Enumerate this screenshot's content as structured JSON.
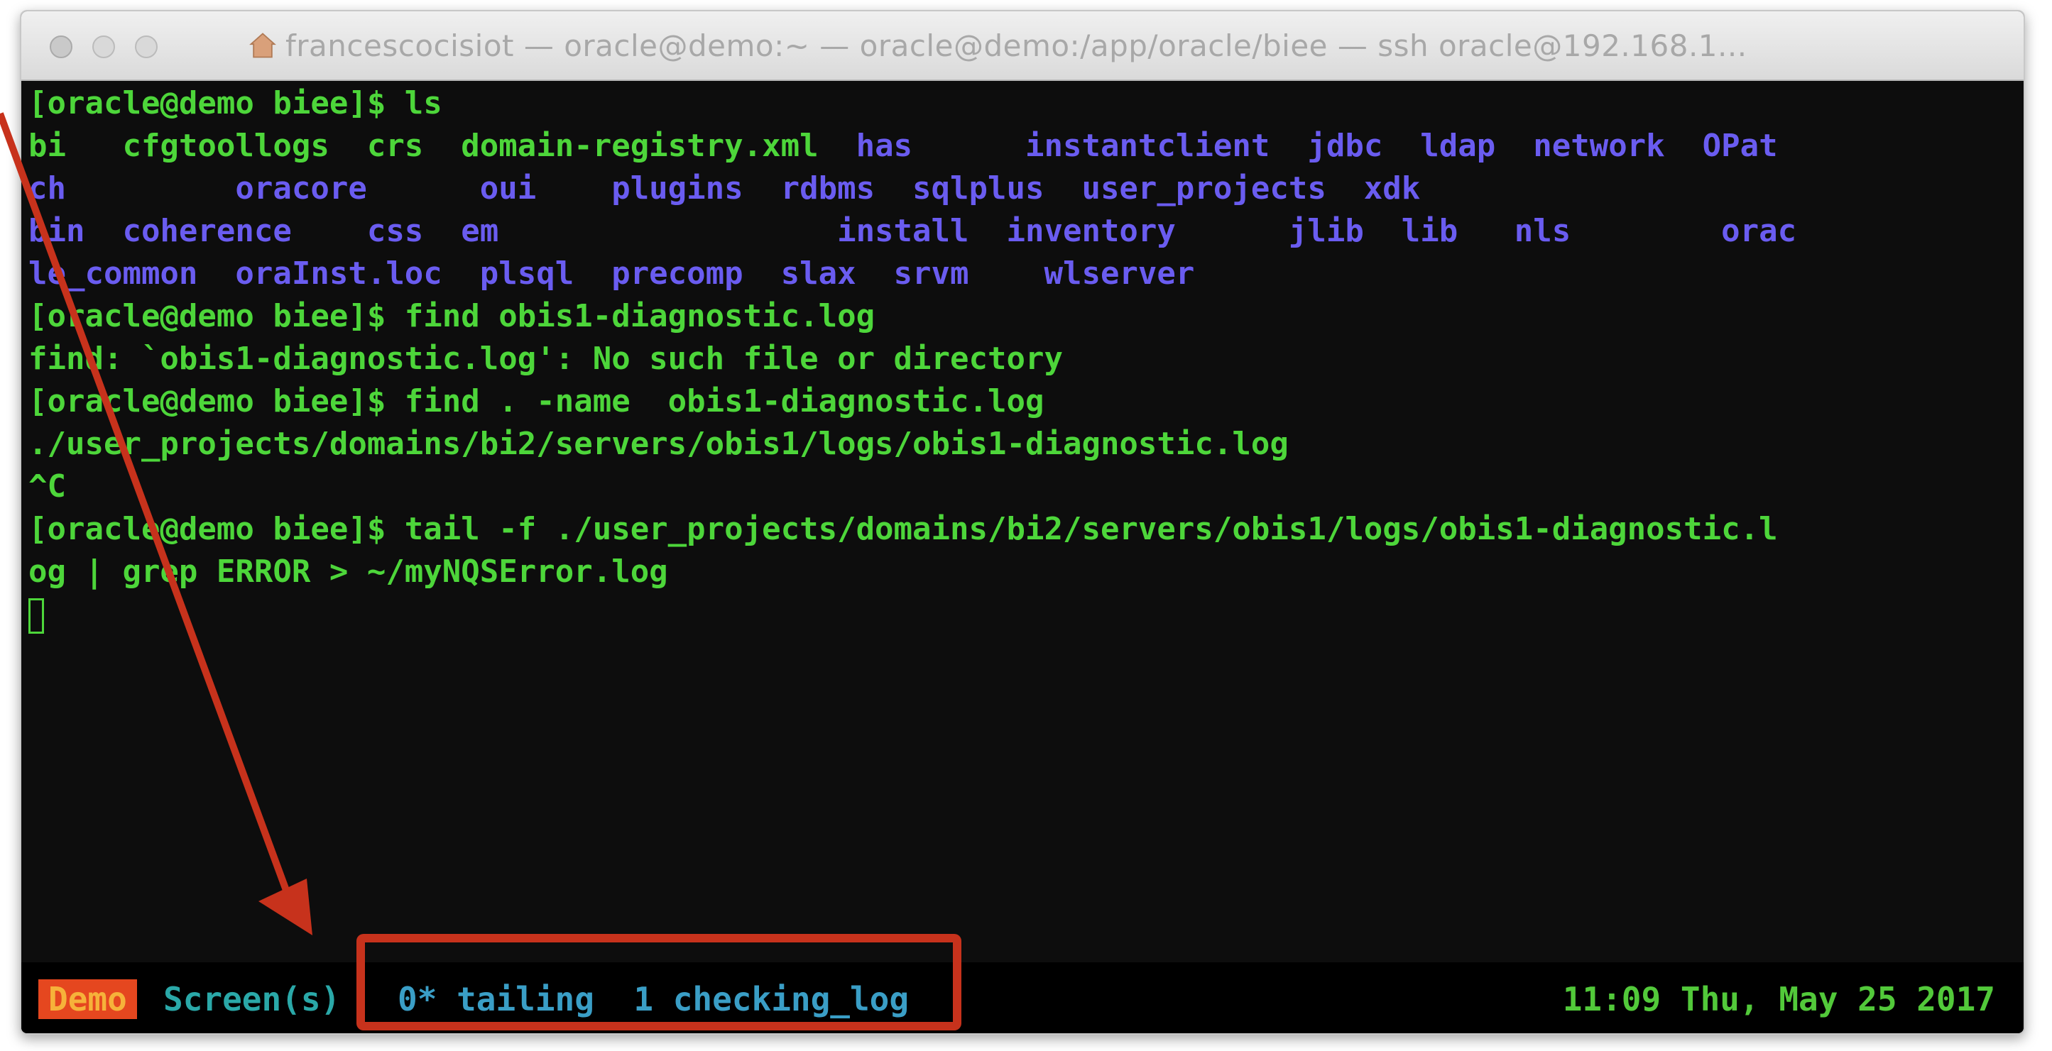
{
  "window": {
    "title": "francescocisiot — oracle@demo:~ — oracle@demo:/app/oracle/biee — ssh oracle@192.168.1..."
  },
  "terminal": {
    "lines": [
      {
        "parts": [
          {
            "text": "[oracle@demo biee]$ ls",
            "style": "green"
          }
        ]
      },
      {
        "parts": [
          {
            "text": "bi   cfgtoollogs  crs  domain-registry.xml  ",
            "style": "green"
          },
          {
            "text": "has      instantclient  jdbc  ldap  network  OPat",
            "style": "blue"
          }
        ]
      },
      {
        "parts": [
          {
            "text": "ch         oracore      oui    plugins  rdbms  sqlplus  user_projects  xdk",
            "style": "blue"
          }
        ]
      },
      {
        "parts": [
          {
            "text": "bin  coherence    css  em                  install  inventory      jlib  lib   nls        orac",
            "style": "blue"
          }
        ]
      },
      {
        "parts": [
          {
            "text": "le_common  oraInst.loc  plsql  precomp  slax  srvm    wlserver",
            "style": "blue"
          }
        ]
      },
      {
        "parts": [
          {
            "text": "[oracle@demo biee]$ find obis1-diagnostic.log",
            "style": "green"
          }
        ]
      },
      {
        "parts": [
          {
            "text": "find: `obis1-diagnostic.log': No such file or directory",
            "style": "green"
          }
        ]
      },
      {
        "parts": [
          {
            "text": "[oracle@demo biee]$ find . -name  obis1-diagnostic.log",
            "style": "green"
          }
        ]
      },
      {
        "parts": [
          {
            "text": "./user_projects/domains/bi2/servers/obis1/logs/obis1-diagnostic.log",
            "style": "green"
          }
        ]
      },
      {
        "parts": [
          {
            "text": "^C",
            "style": "green"
          }
        ]
      },
      {
        "parts": [
          {
            "text": "[oracle@demo biee]$ tail -f ./user_projects/domains/bi2/servers/obis1/logs/obis1-diagnostic.l",
            "style": "green"
          }
        ]
      },
      {
        "parts": [
          {
            "text": "og | grep ERROR > ~/myNQSError.log",
            "style": "green"
          }
        ]
      }
    ]
  },
  "statusbar": {
    "session": "Demo",
    "screens_label": "Screen(s)",
    "windows": "0* tailing  1 checking_log",
    "clock": "11:09 Thu, May 25 2017"
  },
  "colors": {
    "green": "#4dd63a",
    "blue": "#6a5cf0",
    "highlight": "#c7321c"
  }
}
